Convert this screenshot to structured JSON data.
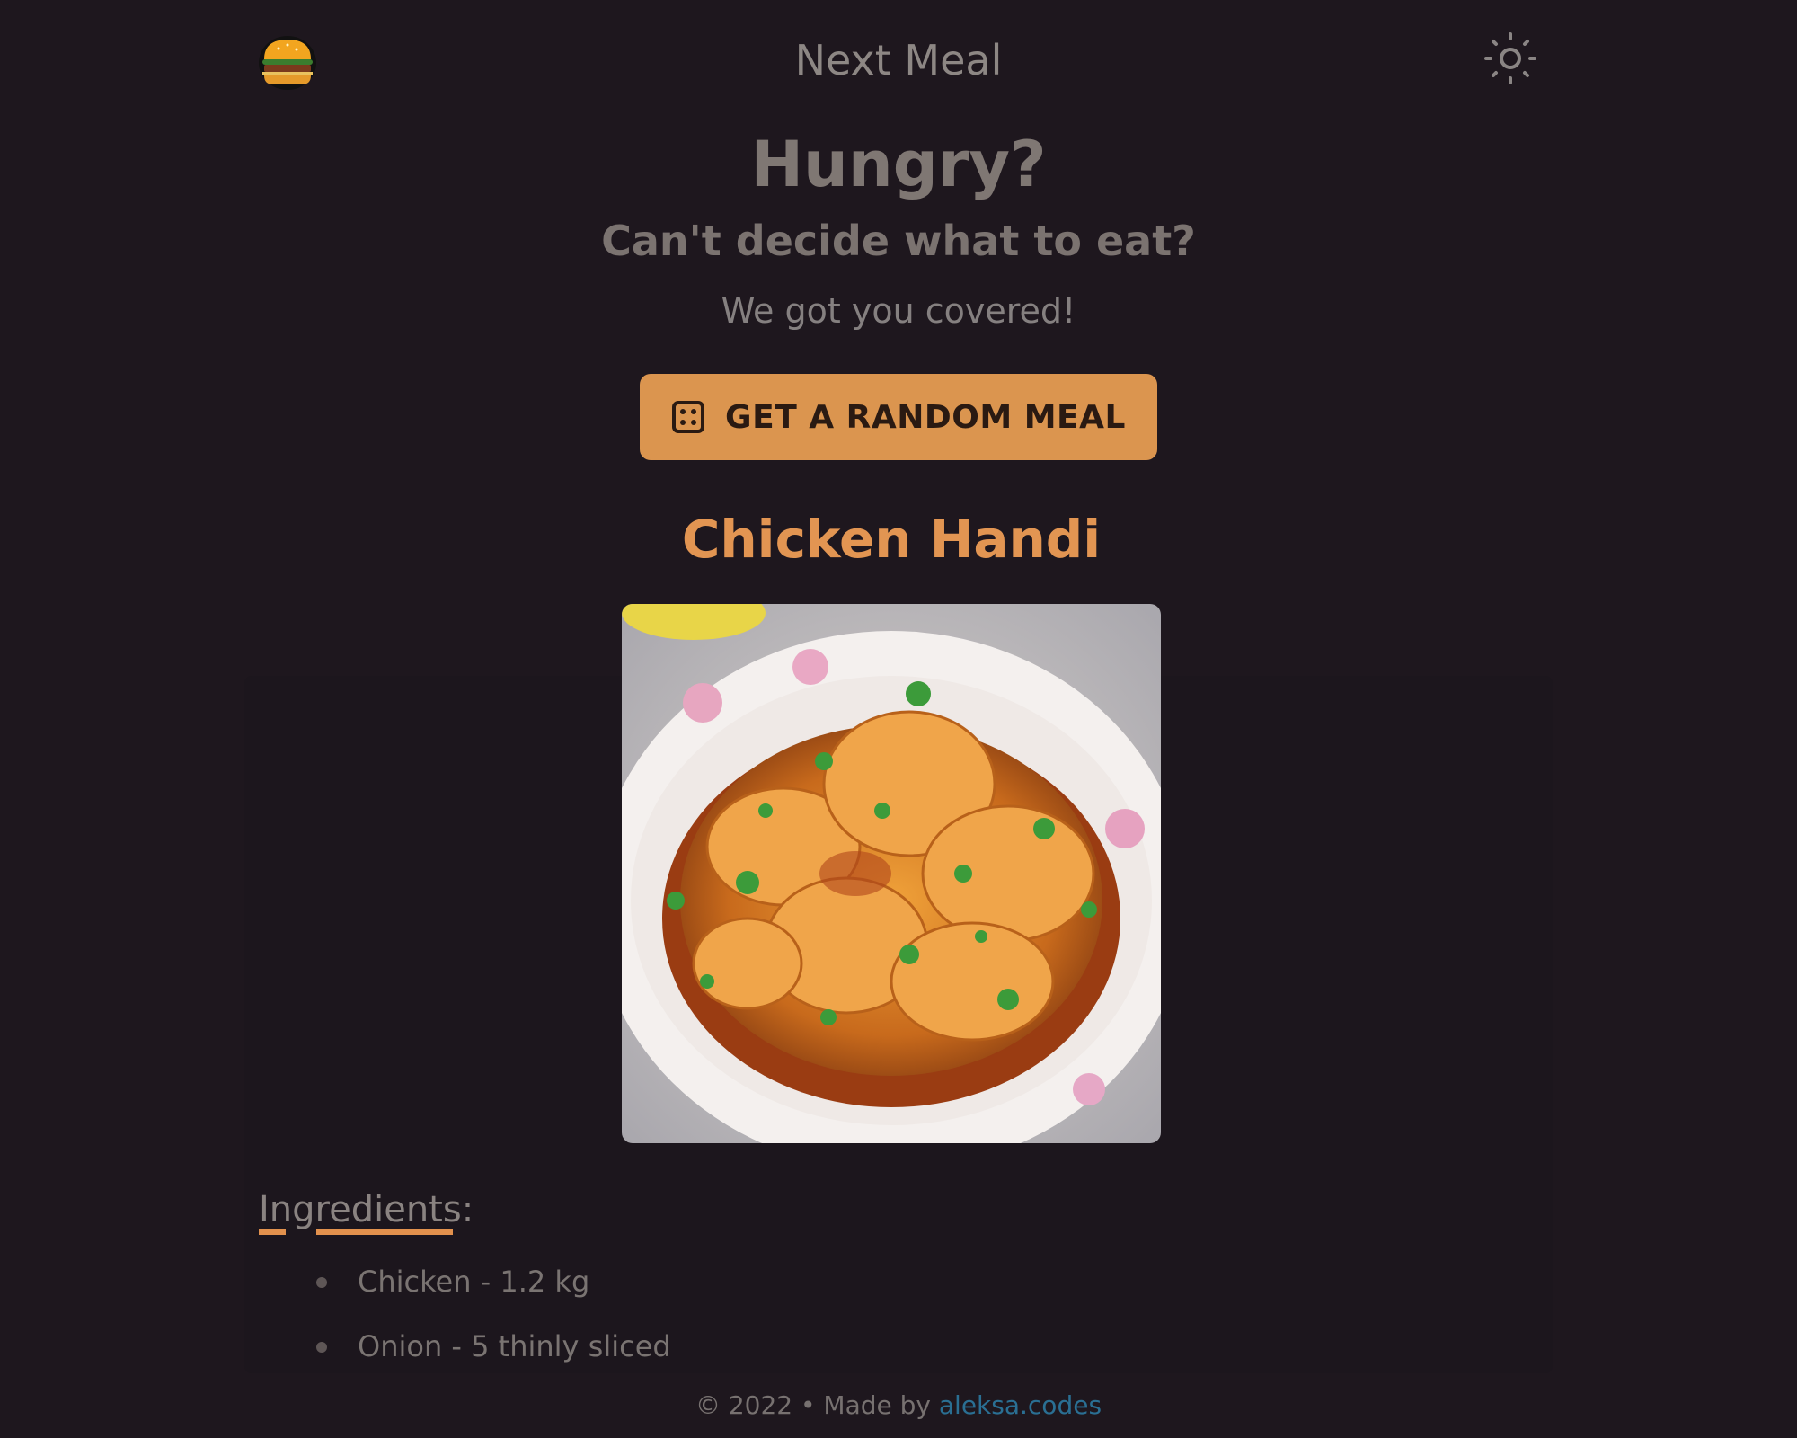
{
  "header": {
    "app_title": "Next Meal",
    "logo_icon": "burger-icon",
    "theme_toggle_icon": "sun-icon"
  },
  "hero": {
    "title": "Hungry?",
    "subtitle": "Can't decide what to eat?",
    "tagline": "We got you covered!",
    "button_label": "GET A RANDOM MEAL",
    "button_icon": "dice-icon"
  },
  "meal": {
    "name": "Chicken Handi",
    "image_alt": "Chicken Handi",
    "ingredients_heading": "Ingredients:",
    "ingredients": [
      "Chicken - 1.2 kg",
      "Onion - 5 thinly sliced"
    ]
  },
  "footer": {
    "prefix": "© 2022 • Made by ",
    "link_text": "aleksa.codes"
  },
  "colors": {
    "background": "#1e171e",
    "accent": "#db954f",
    "meal_title": "#e29552",
    "link": "#2a6f93"
  }
}
